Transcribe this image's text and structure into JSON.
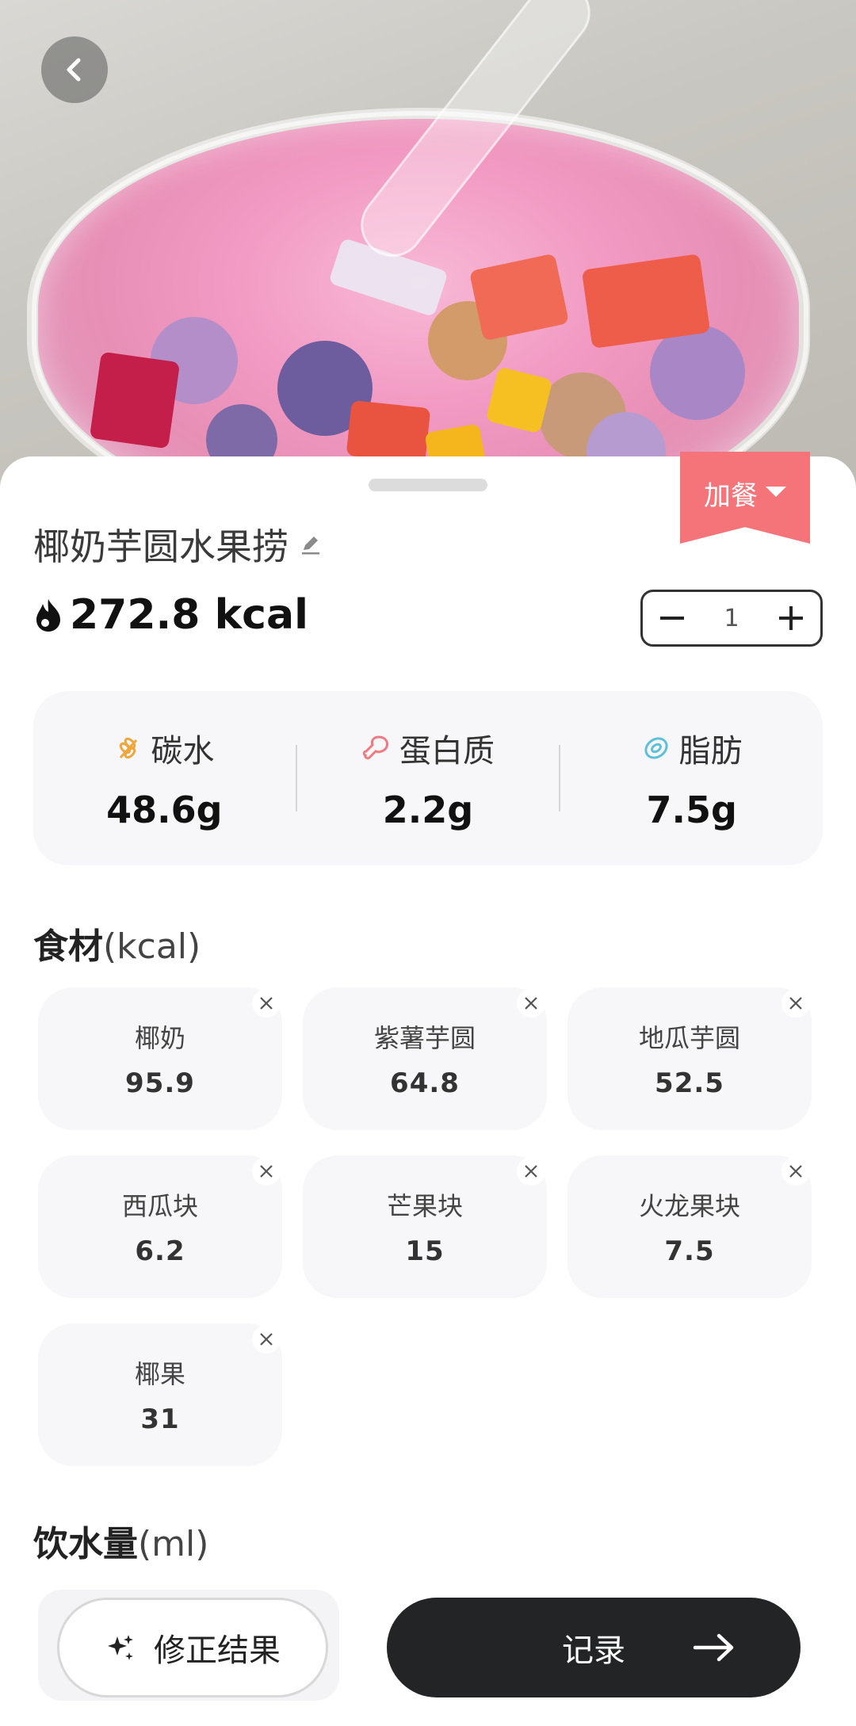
{
  "meal_tag": {
    "label": "加餐"
  },
  "food": {
    "name": "椰奶芋圆水果捞",
    "calories": "272.8 kcal",
    "quantity": "1"
  },
  "macros": [
    {
      "label": "碳水",
      "value": "48.6g",
      "icon": "wheat-icon"
    },
    {
      "label": "蛋白质",
      "value": "2.2g",
      "icon": "drumstick-icon"
    },
    {
      "label": "脂肪",
      "value": "7.5g",
      "icon": "avocado-icon"
    }
  ],
  "ingredients_section": {
    "title": "食材",
    "unit": "(kcal)"
  },
  "ingredients": [
    {
      "name": "椰奶",
      "kcal": "95.9"
    },
    {
      "name": "紫薯芋圆",
      "kcal": "64.8"
    },
    {
      "name": "地瓜芋圆",
      "kcal": "52.5"
    },
    {
      "name": "西瓜块",
      "kcal": "6.2"
    },
    {
      "name": "芒果块",
      "kcal": "15"
    },
    {
      "name": "火龙果块",
      "kcal": "7.5"
    },
    {
      "name": "椰果",
      "kcal": "31"
    }
  ],
  "water_section": {
    "title": "饮水量",
    "unit": "(ml)"
  },
  "actions": {
    "fix_label": "修正结果",
    "record_label": "记录"
  },
  "colors": {
    "meal_tag": "#f47479",
    "record_button": "#222426",
    "card_bg": "#f7f7fa"
  }
}
